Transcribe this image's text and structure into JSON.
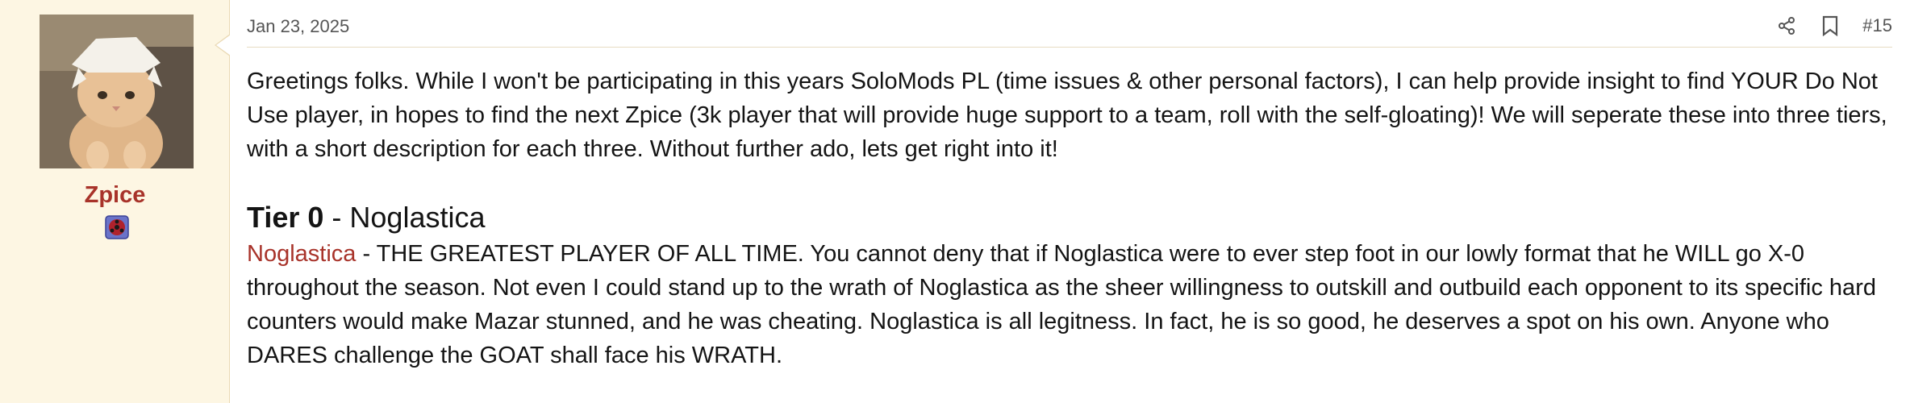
{
  "author": {
    "username": "Zpice"
  },
  "post": {
    "date": "Jan 23, 2025",
    "number": "#15"
  },
  "message": {
    "intro": "Greetings folks. While I won't be participating in this years SoloMods PL (time issues & other personal factors), I can help provide insight to find YOUR Do Not Use player, in hopes to find the next Zpice (3k player that will provide huge support to a team, roll with the self-gloating)! We will seperate these into three tiers, with a short description for each three. Without further ado, lets get right into it!",
    "tier_label": "Tier 0",
    "tier_separator": " - ",
    "tier_player": "Noglastica",
    "player_mention": "Noglastica",
    "player_description": " - THE GREATEST PLAYER OF ALL TIME. You cannot deny that if Noglastica were to ever step foot in our lowly format that he WILL go X-0 throughout the season. Not even I could stand up to the wrath of Noglastica as the sheer willingness to outskill and outbuild each opponent to its specific hard counters would make Mazar stunned, and he was cheating. Noglastica is all legitness. In fact, he is so good, he deserves a spot on his own. Anyone who DARES challenge the GOAT shall face his WRATH."
  },
  "icons": {
    "share": "share-icon",
    "bookmark": "bookmark-icon",
    "badge": "user-badge-icon"
  },
  "colors": {
    "username": "#a8332a",
    "mention": "#a8332a",
    "user_cell_bg": "#fdf6e3",
    "post_bg": "#ffffff",
    "border": "#ead9b4",
    "meta_text": "#555555",
    "body_text": "#141414"
  }
}
